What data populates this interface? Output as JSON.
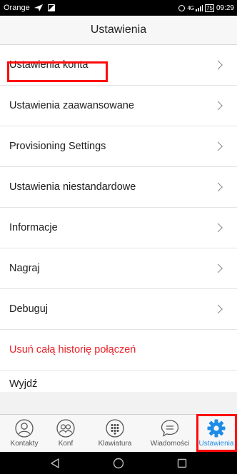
{
  "status_bar": {
    "carrier": "Orange",
    "network": "4G",
    "battery": "75",
    "time": "09:29"
  },
  "header": {
    "title": "Ustawienia"
  },
  "settings": {
    "items": [
      {
        "label": "Ustawienia konta"
      },
      {
        "label": "Ustawienia zaawansowane"
      },
      {
        "label": "Provisioning Settings"
      },
      {
        "label": "Ustawienia niestandardowe"
      },
      {
        "label": "Informacje"
      },
      {
        "label": "Nagraj"
      },
      {
        "label": "Debuguj"
      }
    ],
    "clear_history": "Usuń całą historię połączeń",
    "logout": "Wyjdź"
  },
  "tabs": [
    {
      "label": "Kontakty",
      "icon": "contact-icon"
    },
    {
      "label": "Konf",
      "icon": "conference-icon"
    },
    {
      "label": "Klawiatura",
      "icon": "dialpad-icon"
    },
    {
      "label": "Wiadomości",
      "icon": "message-icon"
    },
    {
      "label": "Ustawienia",
      "icon": "gear-icon",
      "active": true
    }
  ],
  "colors": {
    "accent": "#1e8ce6",
    "danger": "#e8232a",
    "highlight": "#ff0a0a"
  }
}
